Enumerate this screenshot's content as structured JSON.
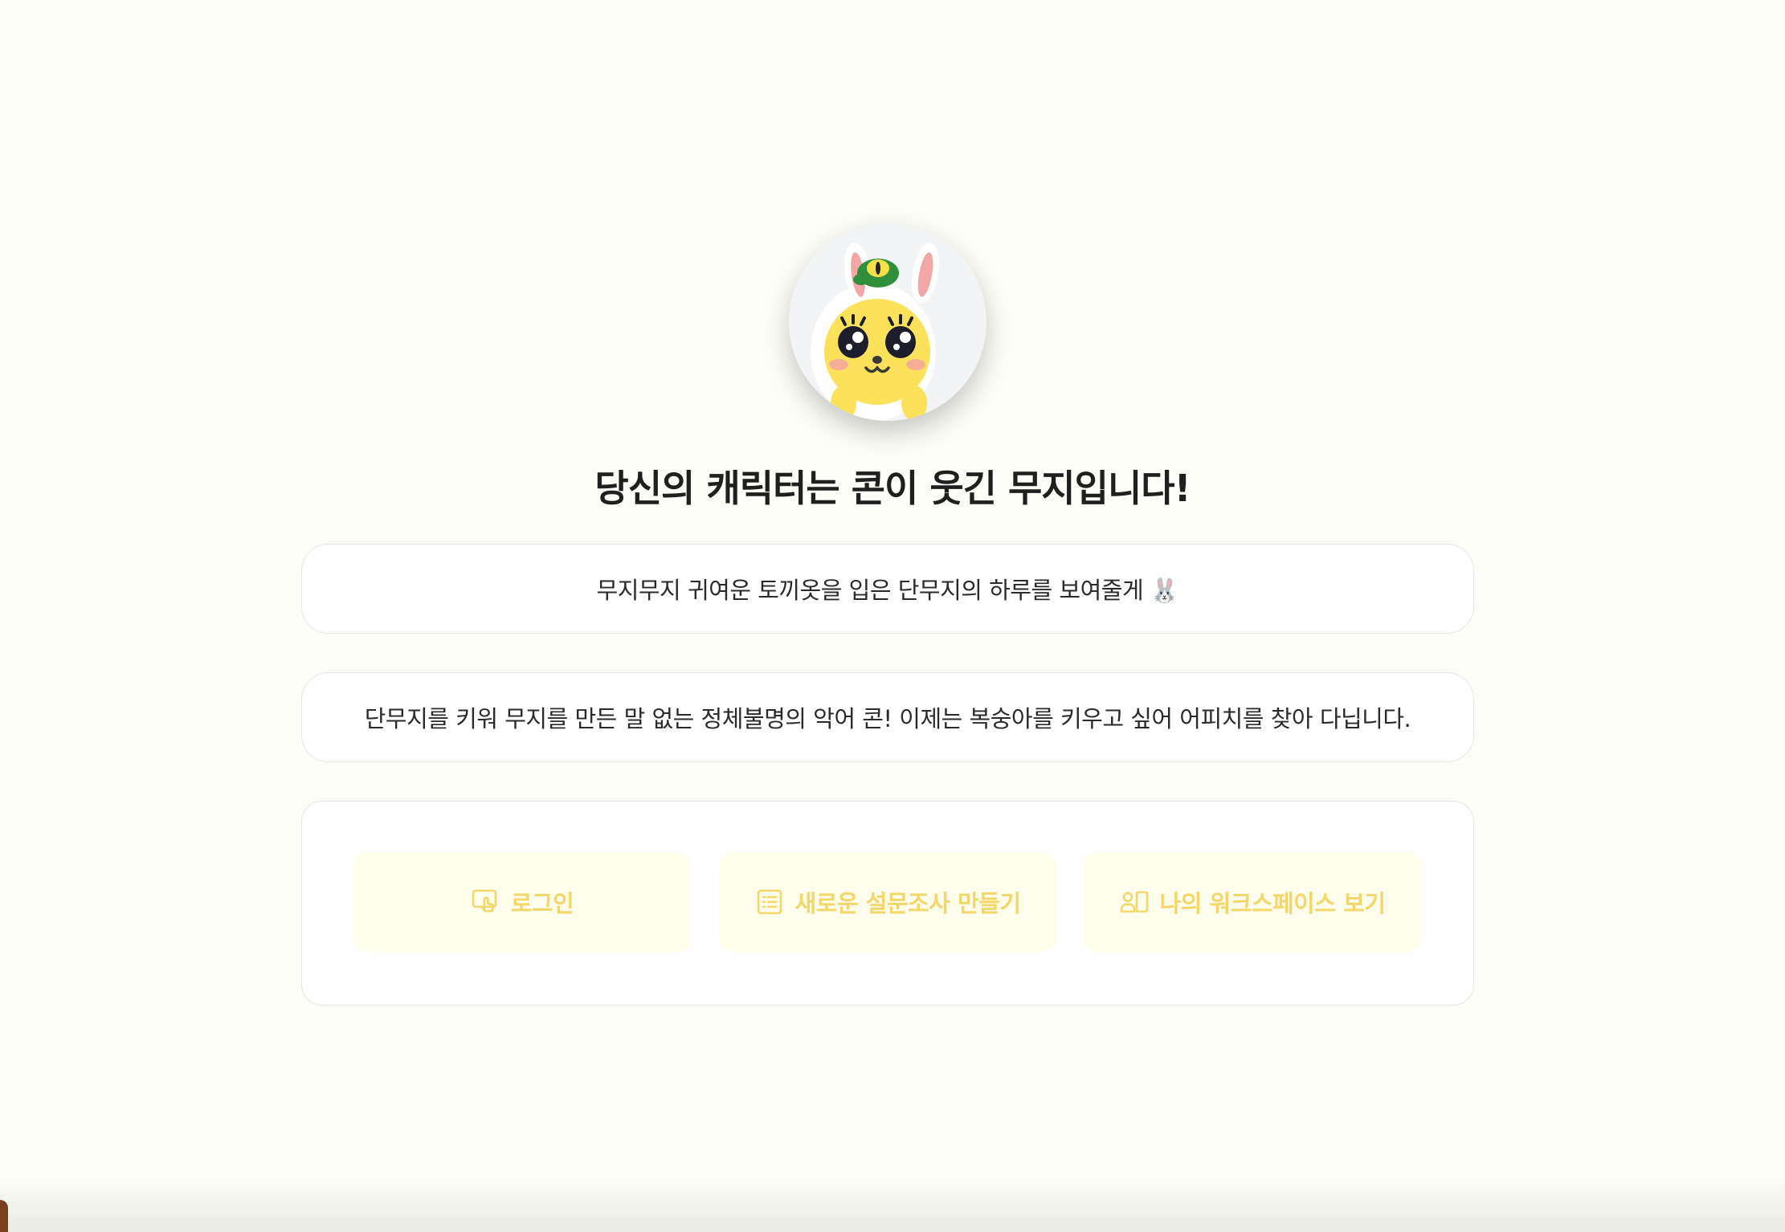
{
  "result": {
    "headline": "당신의 캐릭터는 콘이 웃긴 무지입니다!",
    "description_1": "무지무지 귀여운 토끼옷을 입은 단무지의 하루를 보여줄게 🐰",
    "description_2": "단무지를 키워 무지를 만든 말 없는 정체불명의 악어 콘! 이제는 복숭아를 키우고 싶어 어피치를 찾아 다닙니다."
  },
  "actions": {
    "login_label": "로그인",
    "login_icon": "touch-screen-icon",
    "new_survey_label": "새로운 설문조사 만들기",
    "new_survey_icon": "list-document-icon",
    "workspace_label": "나의 워크스페이스 보기",
    "workspace_icon": "user-workspace-icon"
  },
  "colors": {
    "background": "#fdfdf8",
    "button_bg": "#fffdeb",
    "button_text": "#f4d76a",
    "card_border": "#e6e6e6"
  }
}
